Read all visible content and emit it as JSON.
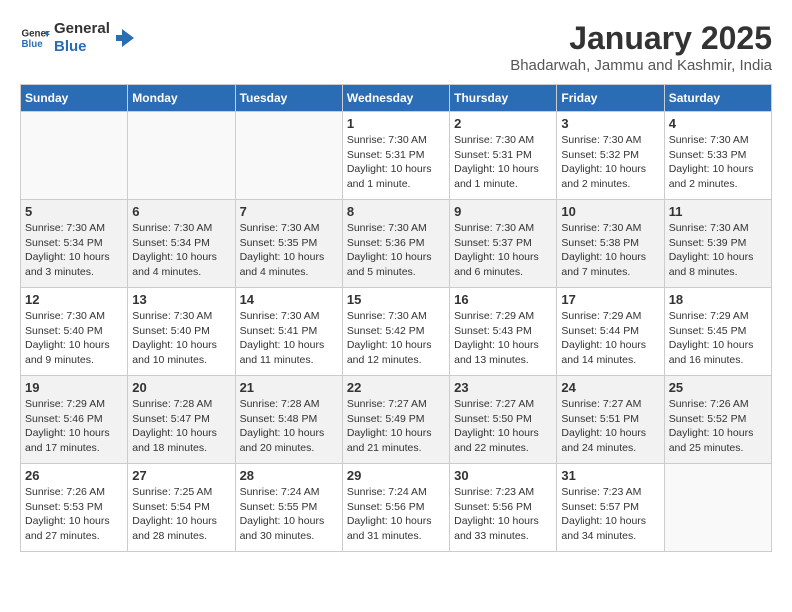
{
  "header": {
    "logo_general": "General",
    "logo_blue": "Blue",
    "title": "January 2025",
    "subtitle": "Bhadarwah, Jammu and Kashmir, India"
  },
  "columns": [
    "Sunday",
    "Monday",
    "Tuesday",
    "Wednesday",
    "Thursday",
    "Friday",
    "Saturday"
  ],
  "weeks": [
    [
      {
        "num": "",
        "info": ""
      },
      {
        "num": "",
        "info": ""
      },
      {
        "num": "",
        "info": ""
      },
      {
        "num": "1",
        "info": "Sunrise: 7:30 AM\nSunset: 5:31 PM\nDaylight: 10 hours\nand 1 minute."
      },
      {
        "num": "2",
        "info": "Sunrise: 7:30 AM\nSunset: 5:31 PM\nDaylight: 10 hours\nand 1 minute."
      },
      {
        "num": "3",
        "info": "Sunrise: 7:30 AM\nSunset: 5:32 PM\nDaylight: 10 hours\nand 2 minutes."
      },
      {
        "num": "4",
        "info": "Sunrise: 7:30 AM\nSunset: 5:33 PM\nDaylight: 10 hours\nand 2 minutes."
      }
    ],
    [
      {
        "num": "5",
        "info": "Sunrise: 7:30 AM\nSunset: 5:34 PM\nDaylight: 10 hours\nand 3 minutes."
      },
      {
        "num": "6",
        "info": "Sunrise: 7:30 AM\nSunset: 5:34 PM\nDaylight: 10 hours\nand 4 minutes."
      },
      {
        "num": "7",
        "info": "Sunrise: 7:30 AM\nSunset: 5:35 PM\nDaylight: 10 hours\nand 4 minutes."
      },
      {
        "num": "8",
        "info": "Sunrise: 7:30 AM\nSunset: 5:36 PM\nDaylight: 10 hours\nand 5 minutes."
      },
      {
        "num": "9",
        "info": "Sunrise: 7:30 AM\nSunset: 5:37 PM\nDaylight: 10 hours\nand 6 minutes."
      },
      {
        "num": "10",
        "info": "Sunrise: 7:30 AM\nSunset: 5:38 PM\nDaylight: 10 hours\nand 7 minutes."
      },
      {
        "num": "11",
        "info": "Sunrise: 7:30 AM\nSunset: 5:39 PM\nDaylight: 10 hours\nand 8 minutes."
      }
    ],
    [
      {
        "num": "12",
        "info": "Sunrise: 7:30 AM\nSunset: 5:40 PM\nDaylight: 10 hours\nand 9 minutes."
      },
      {
        "num": "13",
        "info": "Sunrise: 7:30 AM\nSunset: 5:40 PM\nDaylight: 10 hours\nand 10 minutes."
      },
      {
        "num": "14",
        "info": "Sunrise: 7:30 AM\nSunset: 5:41 PM\nDaylight: 10 hours\nand 11 minutes."
      },
      {
        "num": "15",
        "info": "Sunrise: 7:30 AM\nSunset: 5:42 PM\nDaylight: 10 hours\nand 12 minutes."
      },
      {
        "num": "16",
        "info": "Sunrise: 7:29 AM\nSunset: 5:43 PM\nDaylight: 10 hours\nand 13 minutes."
      },
      {
        "num": "17",
        "info": "Sunrise: 7:29 AM\nSunset: 5:44 PM\nDaylight: 10 hours\nand 14 minutes."
      },
      {
        "num": "18",
        "info": "Sunrise: 7:29 AM\nSunset: 5:45 PM\nDaylight: 10 hours\nand 16 minutes."
      }
    ],
    [
      {
        "num": "19",
        "info": "Sunrise: 7:29 AM\nSunset: 5:46 PM\nDaylight: 10 hours\nand 17 minutes."
      },
      {
        "num": "20",
        "info": "Sunrise: 7:28 AM\nSunset: 5:47 PM\nDaylight: 10 hours\nand 18 minutes."
      },
      {
        "num": "21",
        "info": "Sunrise: 7:28 AM\nSunset: 5:48 PM\nDaylight: 10 hours\nand 20 minutes."
      },
      {
        "num": "22",
        "info": "Sunrise: 7:27 AM\nSunset: 5:49 PM\nDaylight: 10 hours\nand 21 minutes."
      },
      {
        "num": "23",
        "info": "Sunrise: 7:27 AM\nSunset: 5:50 PM\nDaylight: 10 hours\nand 22 minutes."
      },
      {
        "num": "24",
        "info": "Sunrise: 7:27 AM\nSunset: 5:51 PM\nDaylight: 10 hours\nand 24 minutes."
      },
      {
        "num": "25",
        "info": "Sunrise: 7:26 AM\nSunset: 5:52 PM\nDaylight: 10 hours\nand 25 minutes."
      }
    ],
    [
      {
        "num": "26",
        "info": "Sunrise: 7:26 AM\nSunset: 5:53 PM\nDaylight: 10 hours\nand 27 minutes."
      },
      {
        "num": "27",
        "info": "Sunrise: 7:25 AM\nSunset: 5:54 PM\nDaylight: 10 hours\nand 28 minutes."
      },
      {
        "num": "28",
        "info": "Sunrise: 7:24 AM\nSunset: 5:55 PM\nDaylight: 10 hours\nand 30 minutes."
      },
      {
        "num": "29",
        "info": "Sunrise: 7:24 AM\nSunset: 5:56 PM\nDaylight: 10 hours\nand 31 minutes."
      },
      {
        "num": "30",
        "info": "Sunrise: 7:23 AM\nSunset: 5:56 PM\nDaylight: 10 hours\nand 33 minutes."
      },
      {
        "num": "31",
        "info": "Sunrise: 7:23 AM\nSunset: 5:57 PM\nDaylight: 10 hours\nand 34 minutes."
      },
      {
        "num": "",
        "info": ""
      }
    ]
  ]
}
